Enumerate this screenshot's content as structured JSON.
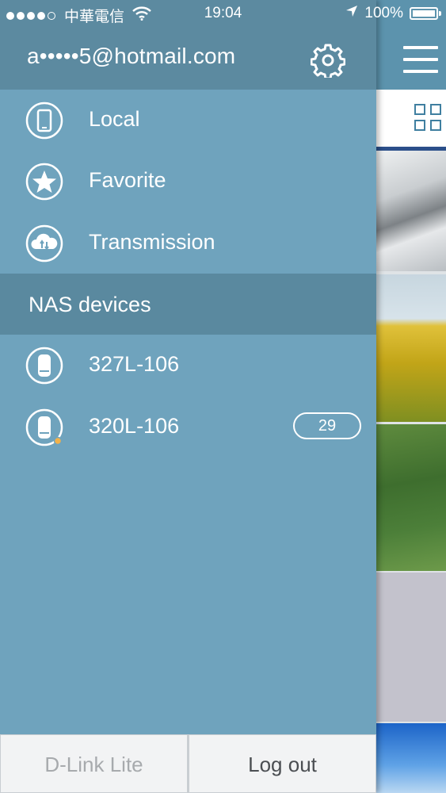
{
  "status_bar": {
    "carrier": "中華電信",
    "time": "19:04",
    "battery_text": "100%",
    "battery_level": 1.0,
    "signal_bars_filled": 4,
    "signal_bars_total": 5
  },
  "account": {
    "email": "a•••••5@hotmail.com"
  },
  "menu": {
    "items": [
      {
        "label": "Local",
        "icon": "phone-icon"
      },
      {
        "label": "Favorite",
        "icon": "star-icon"
      },
      {
        "label": "Transmission",
        "icon": "cloud-transfer-icon"
      }
    ]
  },
  "nas": {
    "section_title": "NAS devices",
    "devices": [
      {
        "label": "327L-106",
        "icon": "nas-drive-icon",
        "badge": ""
      },
      {
        "label": "320L-106",
        "icon": "nas-drive-icon",
        "badge": "29",
        "status_dot": "#f2b24a"
      }
    ]
  },
  "footer": {
    "left_label": "D-Link Lite",
    "right_label": "Log out"
  },
  "colors": {
    "drawer_bg": "#6fa3bd",
    "header_bg": "#5c8aa0",
    "section_bg": "#5a899f",
    "accent_line": "#2b4f8a"
  }
}
